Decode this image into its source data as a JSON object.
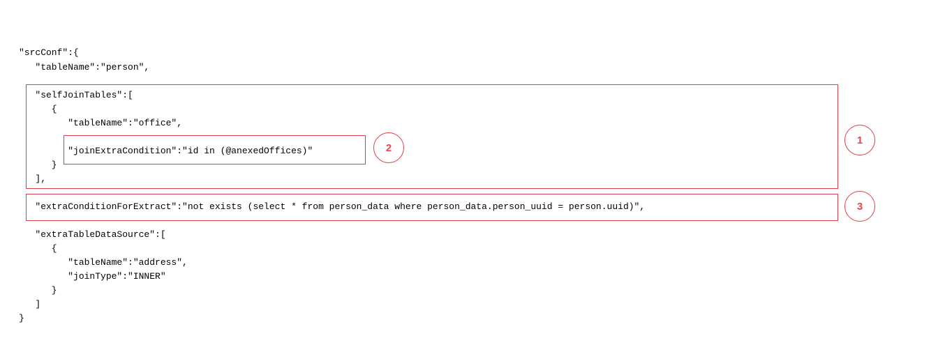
{
  "code_lines": [
    "\"srcConf\":{",
    "   \"tableName\":\"person\",",
    "   \"selfJoinTables\":[",
    "      {",
    "         \"tableName\":\"office\",",
    "         \"joinExtraCondition\":\"id in (@anexedOffices)\"",
    "      }",
    "   ],",
    "   \"extraConditionForExtract\":\"not exists (select * from person_data where person_data.person_uuid = person.uuid)\",",
    "   \"extraTableDataSource\":[",
    "      {",
    "         \"tableName\":\"address\",",
    "         \"joinType\":\"INNER\"",
    "      }",
    "   ]",
    "}"
  ],
  "annotations": [
    {
      "label": "1"
    },
    {
      "label": "2"
    },
    {
      "label": "3"
    }
  ],
  "colors": {
    "annotation": "#d9404a",
    "text": "#000000",
    "background": "#ffffff"
  }
}
